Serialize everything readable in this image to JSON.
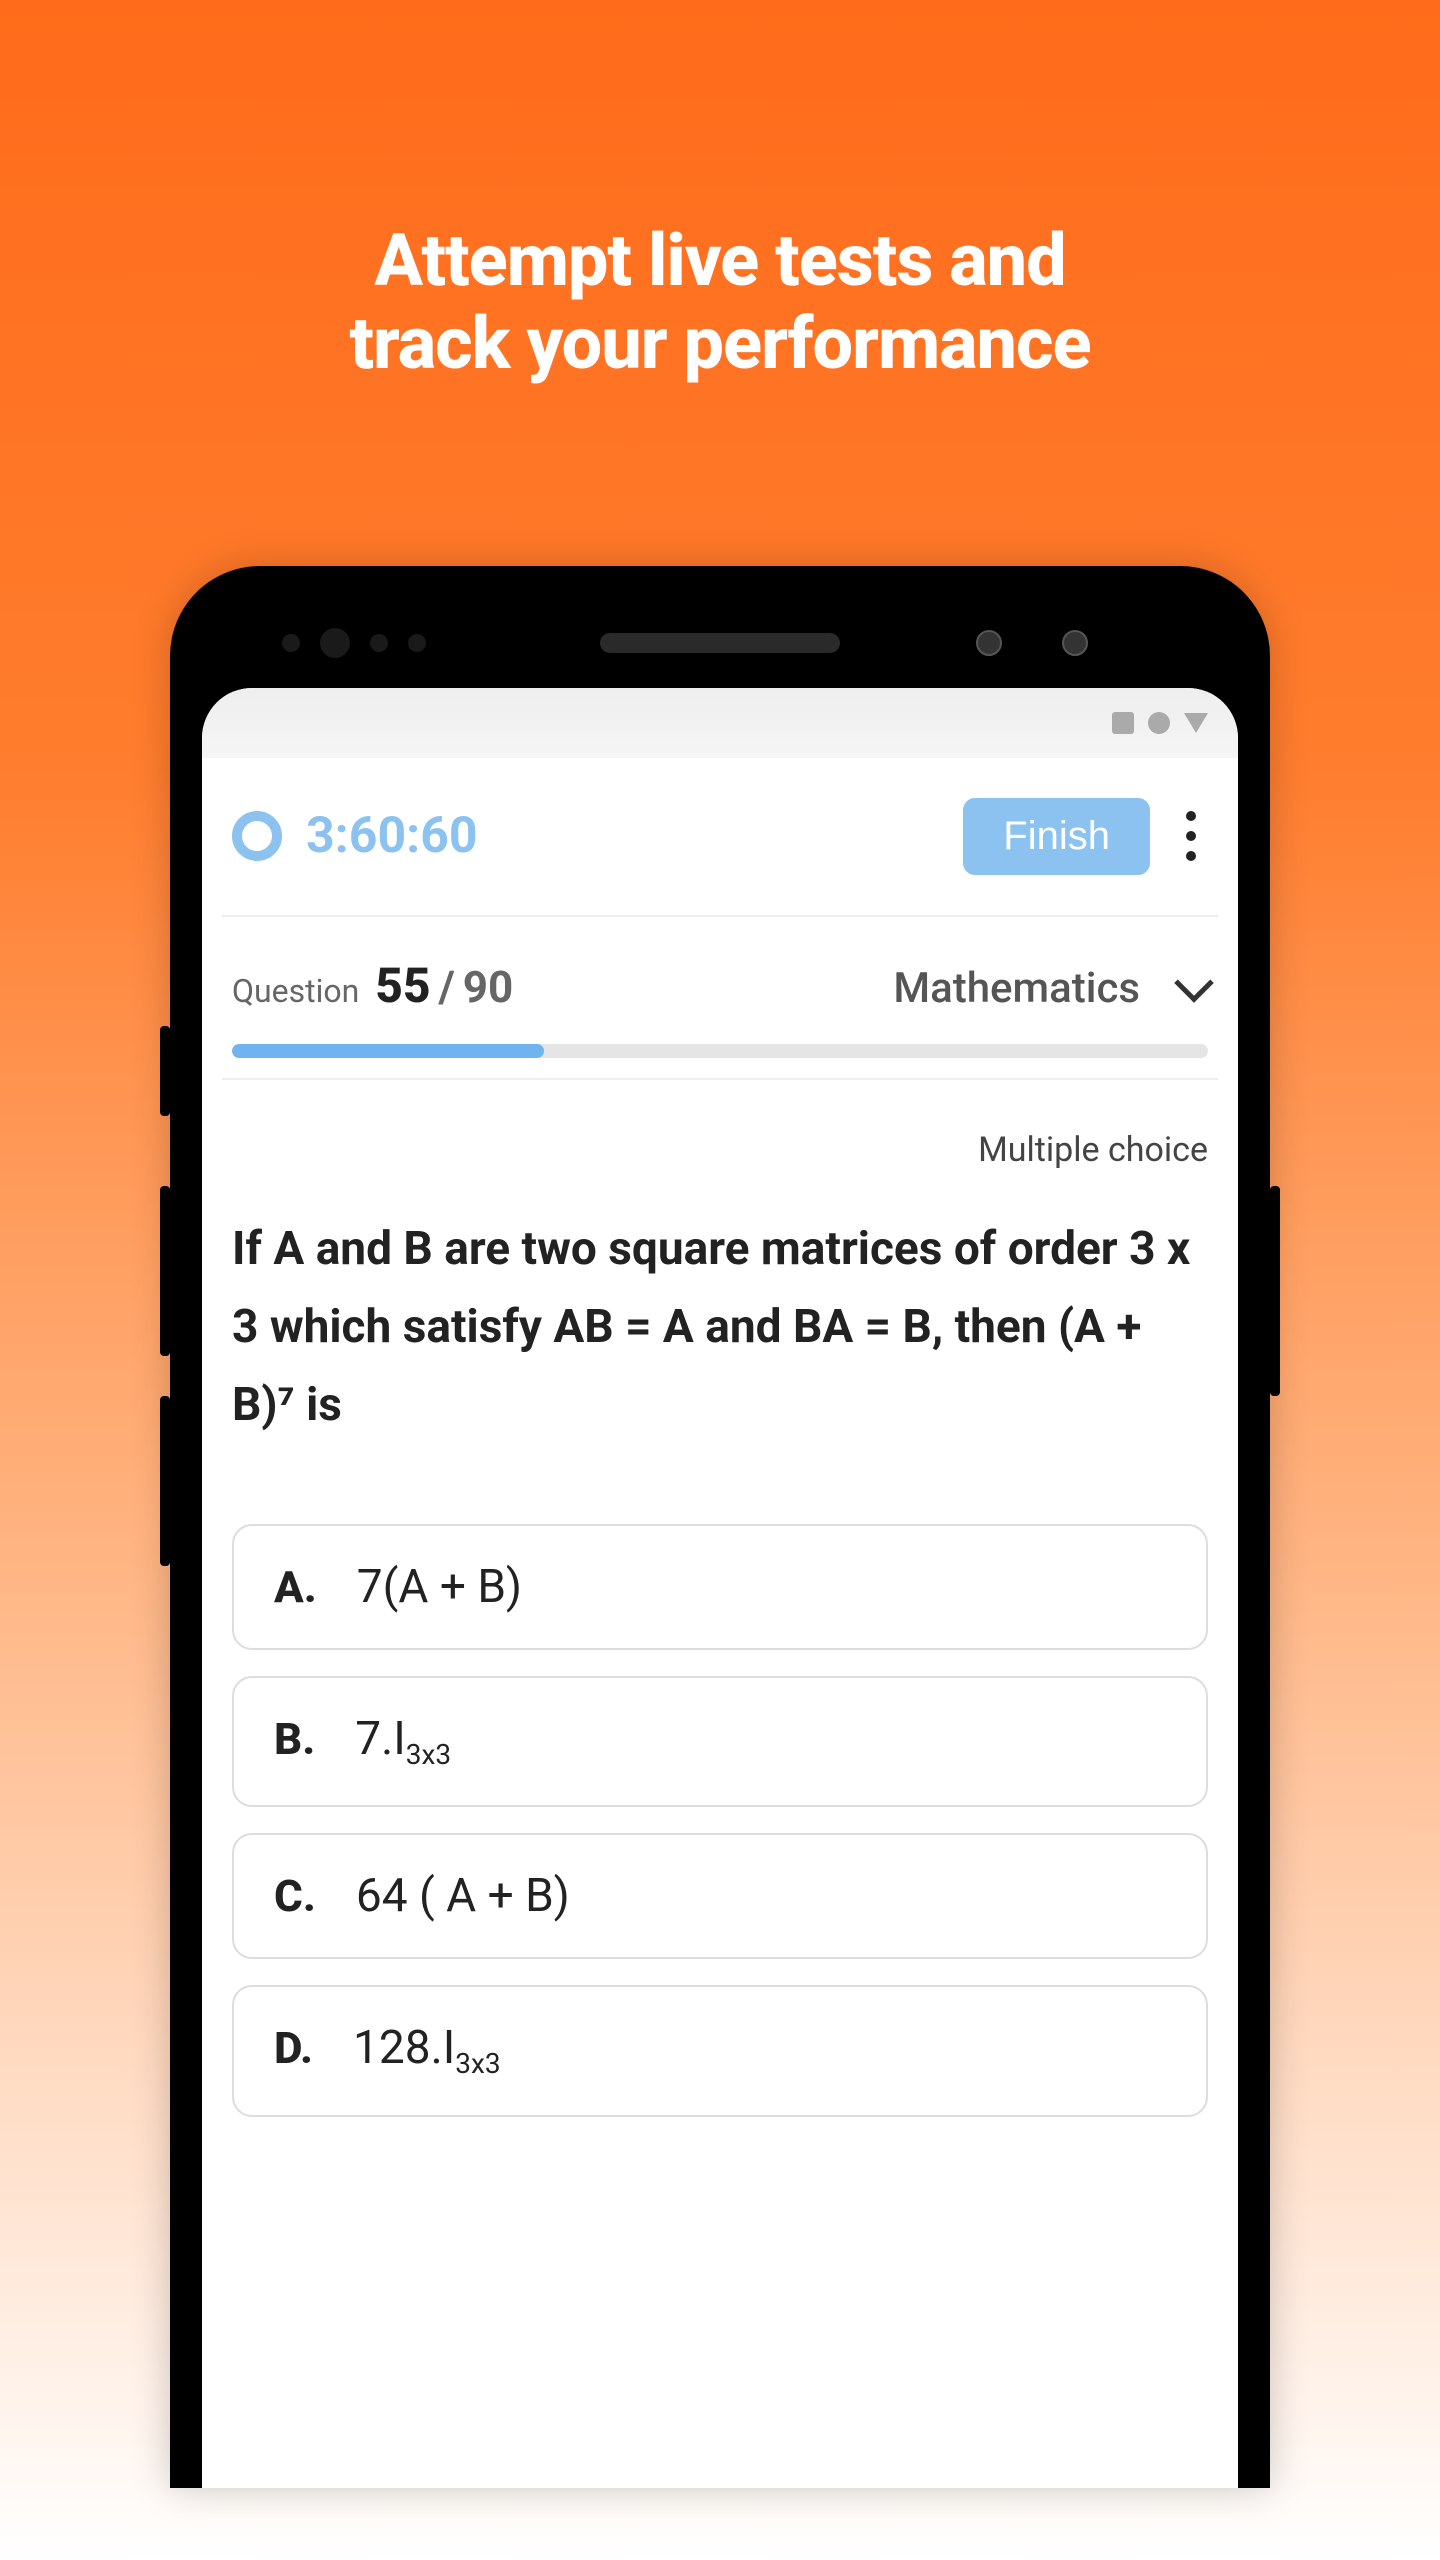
{
  "hero": {
    "line1": "Attempt live tests and",
    "line2": "track your performance"
  },
  "app": {
    "timer": "3:60:60",
    "finish_label": "Finish"
  },
  "question": {
    "label": "Question",
    "current": "55",
    "separator": "/",
    "total": "90",
    "subject": "Mathematics",
    "progress_percent": 32,
    "type": "Multiple choice",
    "text": "If A and B are two square matrices of order 3 x 3 which satisfy AB = A and BA = B, then (A + B)⁷ is"
  },
  "options": {
    "a": {
      "letter": "A.",
      "text": "7(A + B)"
    },
    "b": {
      "letter": "B.",
      "text": "7.I",
      "sub": "3x3"
    },
    "c": {
      "letter": "C.",
      "text": "64 ( A + B)"
    },
    "d": {
      "letter": "D.",
      "text": "128.I",
      "sub": "3x3"
    }
  }
}
